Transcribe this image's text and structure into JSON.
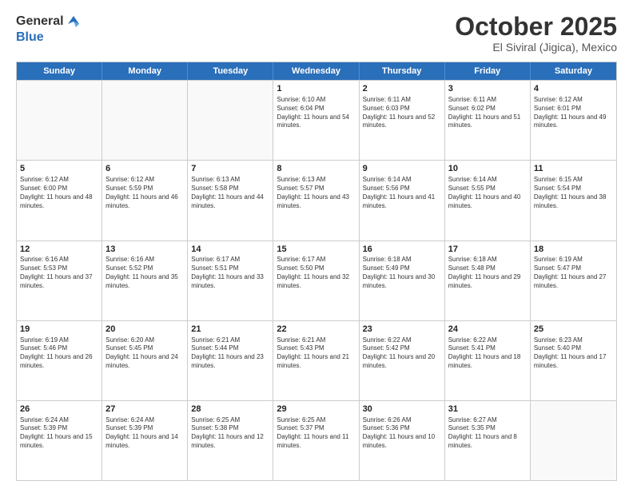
{
  "header": {
    "logo_general": "General",
    "logo_blue": "Blue",
    "month_title": "October 2025",
    "location": "El Siviral (Jigica), Mexico"
  },
  "weekdays": [
    "Sunday",
    "Monday",
    "Tuesday",
    "Wednesday",
    "Thursday",
    "Friday",
    "Saturday"
  ],
  "rows": [
    [
      {
        "day": "",
        "sunrise": "",
        "sunset": "",
        "daylight": ""
      },
      {
        "day": "",
        "sunrise": "",
        "sunset": "",
        "daylight": ""
      },
      {
        "day": "",
        "sunrise": "",
        "sunset": "",
        "daylight": ""
      },
      {
        "day": "1",
        "sunrise": "Sunrise: 6:10 AM",
        "sunset": "Sunset: 6:04 PM",
        "daylight": "Daylight: 11 hours and 54 minutes."
      },
      {
        "day": "2",
        "sunrise": "Sunrise: 6:11 AM",
        "sunset": "Sunset: 6:03 PM",
        "daylight": "Daylight: 11 hours and 52 minutes."
      },
      {
        "day": "3",
        "sunrise": "Sunrise: 6:11 AM",
        "sunset": "Sunset: 6:02 PM",
        "daylight": "Daylight: 11 hours and 51 minutes."
      },
      {
        "day": "4",
        "sunrise": "Sunrise: 6:12 AM",
        "sunset": "Sunset: 6:01 PM",
        "daylight": "Daylight: 11 hours and 49 minutes."
      }
    ],
    [
      {
        "day": "5",
        "sunrise": "Sunrise: 6:12 AM",
        "sunset": "Sunset: 6:00 PM",
        "daylight": "Daylight: 11 hours and 48 minutes."
      },
      {
        "day": "6",
        "sunrise": "Sunrise: 6:12 AM",
        "sunset": "Sunset: 5:59 PM",
        "daylight": "Daylight: 11 hours and 46 minutes."
      },
      {
        "day": "7",
        "sunrise": "Sunrise: 6:13 AM",
        "sunset": "Sunset: 5:58 PM",
        "daylight": "Daylight: 11 hours and 44 minutes."
      },
      {
        "day": "8",
        "sunrise": "Sunrise: 6:13 AM",
        "sunset": "Sunset: 5:57 PM",
        "daylight": "Daylight: 11 hours and 43 minutes."
      },
      {
        "day": "9",
        "sunrise": "Sunrise: 6:14 AM",
        "sunset": "Sunset: 5:56 PM",
        "daylight": "Daylight: 11 hours and 41 minutes."
      },
      {
        "day": "10",
        "sunrise": "Sunrise: 6:14 AM",
        "sunset": "Sunset: 5:55 PM",
        "daylight": "Daylight: 11 hours and 40 minutes."
      },
      {
        "day": "11",
        "sunrise": "Sunrise: 6:15 AM",
        "sunset": "Sunset: 5:54 PM",
        "daylight": "Daylight: 11 hours and 38 minutes."
      }
    ],
    [
      {
        "day": "12",
        "sunrise": "Sunrise: 6:16 AM",
        "sunset": "Sunset: 5:53 PM",
        "daylight": "Daylight: 11 hours and 37 minutes."
      },
      {
        "day": "13",
        "sunrise": "Sunrise: 6:16 AM",
        "sunset": "Sunset: 5:52 PM",
        "daylight": "Daylight: 11 hours and 35 minutes."
      },
      {
        "day": "14",
        "sunrise": "Sunrise: 6:17 AM",
        "sunset": "Sunset: 5:51 PM",
        "daylight": "Daylight: 11 hours and 33 minutes."
      },
      {
        "day": "15",
        "sunrise": "Sunrise: 6:17 AM",
        "sunset": "Sunset: 5:50 PM",
        "daylight": "Daylight: 11 hours and 32 minutes."
      },
      {
        "day": "16",
        "sunrise": "Sunrise: 6:18 AM",
        "sunset": "Sunset: 5:49 PM",
        "daylight": "Daylight: 11 hours and 30 minutes."
      },
      {
        "day": "17",
        "sunrise": "Sunrise: 6:18 AM",
        "sunset": "Sunset: 5:48 PM",
        "daylight": "Daylight: 11 hours and 29 minutes."
      },
      {
        "day": "18",
        "sunrise": "Sunrise: 6:19 AM",
        "sunset": "Sunset: 5:47 PM",
        "daylight": "Daylight: 11 hours and 27 minutes."
      }
    ],
    [
      {
        "day": "19",
        "sunrise": "Sunrise: 6:19 AM",
        "sunset": "Sunset: 5:46 PM",
        "daylight": "Daylight: 11 hours and 26 minutes."
      },
      {
        "day": "20",
        "sunrise": "Sunrise: 6:20 AM",
        "sunset": "Sunset: 5:45 PM",
        "daylight": "Daylight: 11 hours and 24 minutes."
      },
      {
        "day": "21",
        "sunrise": "Sunrise: 6:21 AM",
        "sunset": "Sunset: 5:44 PM",
        "daylight": "Daylight: 11 hours and 23 minutes."
      },
      {
        "day": "22",
        "sunrise": "Sunrise: 6:21 AM",
        "sunset": "Sunset: 5:43 PM",
        "daylight": "Daylight: 11 hours and 21 minutes."
      },
      {
        "day": "23",
        "sunrise": "Sunrise: 6:22 AM",
        "sunset": "Sunset: 5:42 PM",
        "daylight": "Daylight: 11 hours and 20 minutes."
      },
      {
        "day": "24",
        "sunrise": "Sunrise: 6:22 AM",
        "sunset": "Sunset: 5:41 PM",
        "daylight": "Daylight: 11 hours and 18 minutes."
      },
      {
        "day": "25",
        "sunrise": "Sunrise: 6:23 AM",
        "sunset": "Sunset: 5:40 PM",
        "daylight": "Daylight: 11 hours and 17 minutes."
      }
    ],
    [
      {
        "day": "26",
        "sunrise": "Sunrise: 6:24 AM",
        "sunset": "Sunset: 5:39 PM",
        "daylight": "Daylight: 11 hours and 15 minutes."
      },
      {
        "day": "27",
        "sunrise": "Sunrise: 6:24 AM",
        "sunset": "Sunset: 5:39 PM",
        "daylight": "Daylight: 11 hours and 14 minutes."
      },
      {
        "day": "28",
        "sunrise": "Sunrise: 6:25 AM",
        "sunset": "Sunset: 5:38 PM",
        "daylight": "Daylight: 11 hours and 12 minutes."
      },
      {
        "day": "29",
        "sunrise": "Sunrise: 6:25 AM",
        "sunset": "Sunset: 5:37 PM",
        "daylight": "Daylight: 11 hours and 11 minutes."
      },
      {
        "day": "30",
        "sunrise": "Sunrise: 6:26 AM",
        "sunset": "Sunset: 5:36 PM",
        "daylight": "Daylight: 11 hours and 10 minutes."
      },
      {
        "day": "31",
        "sunrise": "Sunrise: 6:27 AM",
        "sunset": "Sunset: 5:35 PM",
        "daylight": "Daylight: 11 hours and 8 minutes."
      },
      {
        "day": "",
        "sunrise": "",
        "sunset": "",
        "daylight": ""
      }
    ]
  ]
}
